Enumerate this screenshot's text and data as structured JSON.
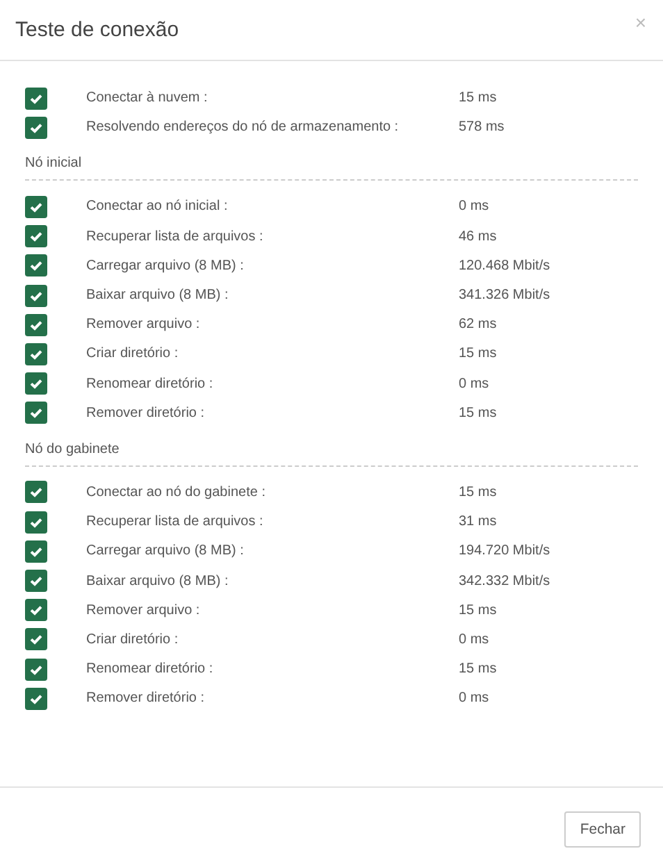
{
  "dialog": {
    "title": "Teste de conexão",
    "close": "×"
  },
  "groups": [
    {
      "rows": [
        {
          "label": "Conectar à nuvem :",
          "value": "15 ms",
          "passed": true
        },
        {
          "label": "Resolvendo endereços do nó de armazenamento :",
          "value": "578 ms",
          "passed": true
        }
      ]
    },
    {
      "heading": "Nó inicial",
      "rows": [
        {
          "label": "Conectar ao nó inicial :",
          "value": "0 ms",
          "passed": true
        },
        {
          "label": "Recuperar lista de arquivos :",
          "value": "46 ms",
          "passed": true
        },
        {
          "label": "Carregar arquivo (8 MB) :",
          "value": "120.468 Mbit/s",
          "passed": true
        },
        {
          "label": "Baixar arquivo (8 MB) :",
          "value": "341.326 Mbit/s",
          "passed": true
        },
        {
          "label": "Remover arquivo :",
          "value": "62 ms",
          "passed": true
        },
        {
          "label": "Criar diretório :",
          "value": "15 ms",
          "passed": true
        },
        {
          "label": "Renomear diretório :",
          "value": "0 ms",
          "passed": true
        },
        {
          "label": "Remover diretório :",
          "value": "15 ms",
          "passed": true
        }
      ]
    },
    {
      "heading": "Nó do gabinete",
      "rows": [
        {
          "label": "Conectar ao nó do gabinete :",
          "value": "15 ms",
          "passed": true
        },
        {
          "label": "Recuperar lista de arquivos :",
          "value": "31 ms",
          "passed": true
        },
        {
          "label": "Carregar arquivo (8 MB) :",
          "value": "194.720 Mbit/s",
          "passed": true
        },
        {
          "label": "Baixar arquivo (8 MB) :",
          "value": "342.332 Mbit/s",
          "passed": true
        },
        {
          "label": "Remover arquivo :",
          "value": "15 ms",
          "passed": true
        },
        {
          "label": "Criar diretório :",
          "value": "0 ms",
          "passed": true
        },
        {
          "label": "Renomear diretório :",
          "value": "15 ms",
          "passed": true
        },
        {
          "label": "Remover diretório :",
          "value": "0 ms",
          "passed": true
        }
      ]
    }
  ],
  "buttons": [
    "Fechar"
  ]
}
